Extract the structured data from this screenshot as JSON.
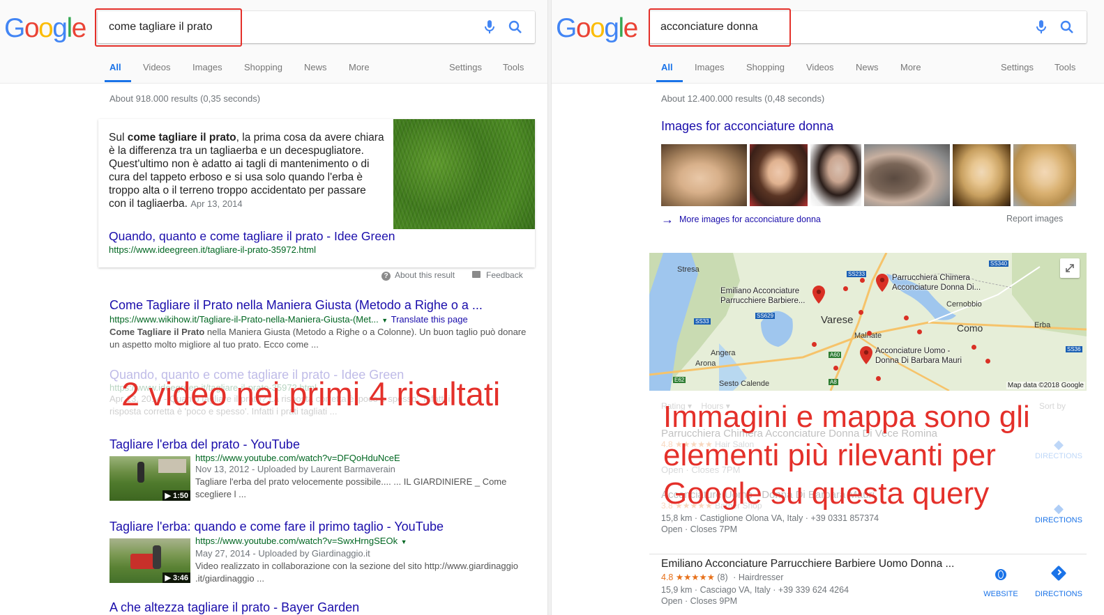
{
  "left": {
    "logo": "Google",
    "query": "come tagliare il prato",
    "tabs": [
      "All",
      "Videos",
      "Images",
      "Shopping",
      "News",
      "More"
    ],
    "tools": [
      "Settings",
      "Tools"
    ],
    "stats": "About 918.000 results (0,35 seconds)",
    "featured": {
      "text_pre": "Sul ",
      "text_bold": "come tagliare il prato",
      "text_post": ", la prima cosa da avere chiara è la differenza tra un tagliaerba e un decespugliatore. Quest'ultimo non è adatto ai tagli di mantenimento o di cura del tappeto erboso e si usa solo quando l'erba è troppo alta o il terreno troppo accidentato per passare con il tagliaerba.",
      "date": "Apr 13, 2014",
      "title": "Quando, quanto e come tagliare il prato - Idee Green",
      "url": "https://www.ideegreen.it/tagliare-il-prato-35972.html",
      "about": "About this result",
      "feedback": "Feedback"
    },
    "results": [
      {
        "title": "Come Tagliare il Prato nella Maniera Giusta (Metodo a Righe o a ...",
        "url": "https://www.wikihow.it/Tagliare-il-Prato-nella-Maniera-Giusta-(Met...",
        "translate": "Translate this page",
        "snippet_bold": "Come Tagliare il Prato",
        "snippet_1": " nella Maniera Giusta (Metodo a Righe o a Colonne). Un buon taglio può donare",
        "snippet_2": "un aspetto molto migliore al tuo prato. Ecco come ..."
      },
      {
        "title": "Quando, quanto e come tagliare il prato - Idee Green",
        "url": "https://www.ideegreen.it/tagliare-il-prato-35972.html",
        "snippet_1": "Apr 13, 2014 - Quanto tagliare il prato? La risposta corretta è 'poco e spesso'. Infatti i",
        "snippet_2": "risposta corretta è 'poco e spesso'. Infatti i prati tagliati ..."
      }
    ],
    "videos": [
      {
        "title": "Tagliare l'erba del prato - YouTube",
        "url": "https://www.youtube.com/watch?v=DFQoHduNceE",
        "meta": "Nov 13, 2012 - Uploaded by Laurent Barmaverain",
        "desc_1": "Tagliare l'erba del prato velocemente possibile.... ... IL GIARDINIERE _ Come",
        "desc_2": "scegliere l ...",
        "duration": "1:50"
      },
      {
        "title": "Tagliare l'erba: quando e come fare il primo taglio - YouTube",
        "url": "https://www.youtube.com/watch?v=SwxHrngSEOk",
        "meta": "May 27, 2014 - Uploaded by Giardinaggio.it",
        "desc_1": "Video realizzato in collaborazione con la sezione del sito http://www.giardinaggio",
        "desc_2": ".it/giardinaggio ...",
        "duration": "3:46"
      }
    ],
    "last_title": "A che altezza tagliare il prato - Bayer Garden",
    "overlay": "2 video nei primi 4 risultati"
  },
  "right": {
    "logo": "Google",
    "query": "acconciature donna",
    "tabs": [
      "All",
      "Images",
      "Shopping",
      "Videos",
      "News",
      "More"
    ],
    "tools": [
      "Settings",
      "Tools"
    ],
    "stats": "About 12.400.000 results (0,48 seconds)",
    "images_header": "Images for acconciature donna",
    "more_images": "More images for acconciature donna",
    "report_images": "Report images",
    "map": {
      "copyright": "Map data ©2018 Google",
      "places": [
        "Stresa",
        "Varese",
        "Como",
        "Cernobbio",
        "Erba",
        "Angera",
        "Arona",
        "Sesto Calende",
        "Malnate"
      ],
      "roads": [
        "SS233",
        "SS340",
        "SS33",
        "SS629",
        "A60",
        "A8",
        "SS36",
        "E62"
      ],
      "pins": [
        {
          "name_1": "Parrucchiera Chimera",
          "name_2": "Acconciature Donna Di..."
        },
        {
          "name_1": "Emiliano Acconciature",
          "name_2": "Parrucchiere Barbiere..."
        },
        {
          "name_1": "Acconciature Uomo -",
          "name_2": "Donna Di Barbara Mauri"
        }
      ]
    },
    "filters": [
      "Rating",
      "Hours",
      "Sort by"
    ],
    "listings": [
      {
        "name": "Parrucchiera Chimera Acconciature Donna Di Vece Romina",
        "rating": "4.8",
        "reviews": "",
        "type": "Hair Salon",
        "addr": "",
        "hours": "Open · Closes 7PM",
        "action": "DIRECTIONS"
      },
      {
        "name": "Acconciature Uomo - Donna Di Barbara Mauri",
        "rating": "3.8",
        "reviews": "",
        "type": "Barber Shop",
        "addr": "15,8 km · Castiglione Olona VA, Italy · +39 0331 857374",
        "hours": "Open · Closes 7PM",
        "action": "DIRECTIONS"
      },
      {
        "name": "Emiliano Acconciature Parrucchiere Barbiere Uomo Donna ...",
        "rating": "4.8",
        "reviews": "(8)",
        "type": "Hairdresser",
        "addr": "15,9 km · Casciago VA, Italy · +39 339 624 4264",
        "hours": "Open · Closes 9PM",
        "website": "WEBSITE",
        "action": "DIRECTIONS"
      }
    ],
    "overlay": [
      "Immagini e mappa sono gli",
      "elementi più rilevanti per",
      "Google su questa query"
    ],
    "colors": {
      "accent": "#e4302a",
      "link": "#1a0dab",
      "url": "#006621"
    }
  }
}
